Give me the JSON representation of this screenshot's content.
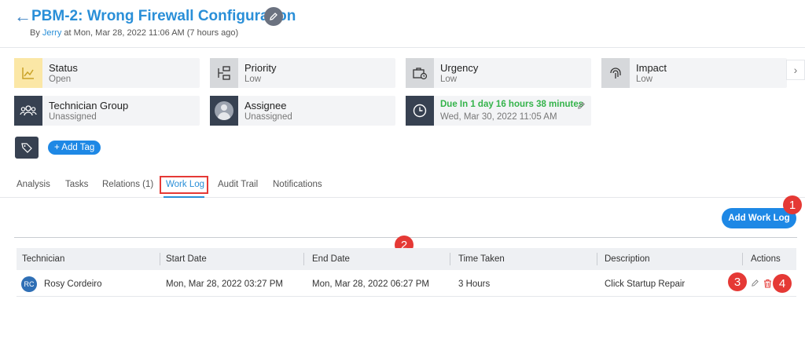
{
  "header": {
    "back_glyph": "←",
    "title": "PBM-2: Wrong Firewall Configuration",
    "subtitle_prefix": "By",
    "author": "Jerry",
    "subtitle_suffix": "at Mon, Mar 28, 2022 11:06 AM (7 hours ago)"
  },
  "cards": {
    "status": {
      "label": "Status",
      "value": "Open"
    },
    "priority": {
      "label": "Priority",
      "value": "Low"
    },
    "urgency": {
      "label": "Urgency",
      "value": "Low"
    },
    "impact": {
      "label": "Impact",
      "value": "Low"
    },
    "technician_group": {
      "label": "Technician Group",
      "value": "Unassigned"
    },
    "assignee": {
      "label": "Assignee",
      "value": "Unassigned"
    },
    "due": {
      "label": "Due In  1 day 16 hours 38 minutes",
      "value": "Wed, Mar 30, 2022 11:05 AM"
    }
  },
  "tags": {
    "add_label": "+ Add Tag"
  },
  "tabs": [
    {
      "label": "Analysis"
    },
    {
      "label": "Tasks"
    },
    {
      "label": "Relations (1)"
    },
    {
      "label": "Work Log"
    },
    {
      "label": "Audit Trail"
    },
    {
      "label": "Notifications"
    }
  ],
  "actions": {
    "add_worklog_label": "Add Work Log"
  },
  "markers": [
    "1",
    "2",
    "3",
    "4"
  ],
  "table": {
    "columns": [
      "Technician",
      "Start Date",
      "End Date",
      "Time Taken",
      "Description",
      "Actions"
    ],
    "rows": [
      {
        "initials": "RC",
        "technician": "Rosy Cordeiro",
        "start": "Mon, Mar 28, 2022 03:27 PM",
        "end": "Mon, Mar 28, 2022 06:27 PM",
        "time": "3 Hours",
        "description": "Click Startup Repair"
      }
    ]
  },
  "colors": {
    "accent": "#1e88e5",
    "marker": "#e53935",
    "due_green": "#34b34a"
  }
}
